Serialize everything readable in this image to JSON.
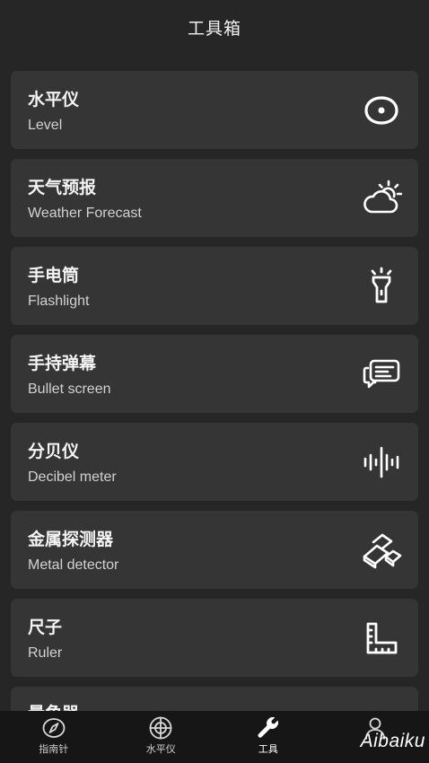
{
  "header": {
    "title": "工具箱"
  },
  "tools": [
    {
      "title": "水平仪",
      "subtitle": "Level",
      "icon": "level-icon"
    },
    {
      "title": "天气预报",
      "subtitle": "Weather Forecast",
      "icon": "weather-icon"
    },
    {
      "title": "手电筒",
      "subtitle": "Flashlight",
      "icon": "flashlight-icon"
    },
    {
      "title": "手持弹幕",
      "subtitle": "Bullet screen",
      "icon": "bullet-screen-icon"
    },
    {
      "title": "分贝仪",
      "subtitle": "Decibel meter",
      "icon": "decibel-icon"
    },
    {
      "title": "金属探测器",
      "subtitle": "Metal detector",
      "icon": "metal-detector-icon"
    },
    {
      "title": "尺子",
      "subtitle": "Ruler",
      "icon": "ruler-icon"
    },
    {
      "title": "量角器",
      "subtitle": "",
      "icon": ""
    }
  ],
  "tabs": [
    {
      "label": "指南针",
      "icon": "compass-icon",
      "active": false
    },
    {
      "label": "水平仪",
      "icon": "level-tab-icon",
      "active": false
    },
    {
      "label": "工具",
      "icon": "wrench-icon",
      "active": true
    },
    {
      "label": "",
      "icon": "profile-icon",
      "active": false
    }
  ],
  "watermark": "Aibaiku",
  "colors": {
    "background": "#262626",
    "card": "#353535",
    "tabbar": "#161616",
    "text": "#ffffff"
  }
}
